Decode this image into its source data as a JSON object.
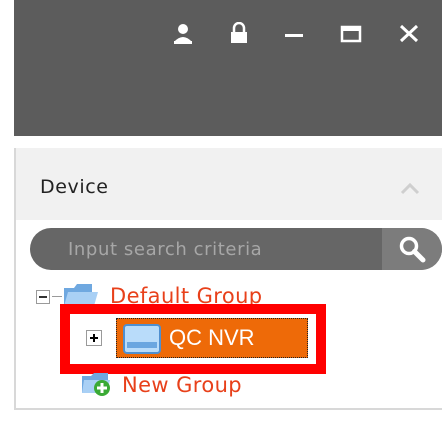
{
  "window": {
    "controls": [
      "user-icon",
      "lock-icon",
      "minimize-icon",
      "maximize-icon",
      "close-icon"
    ]
  },
  "panel": {
    "title": "Device"
  },
  "search": {
    "placeholder": "Input search criteria"
  },
  "tree": {
    "group_label": "Default Group",
    "device_label": "QC NVR",
    "new_group_label": "New Group"
  },
  "colors": {
    "titlebar": "#5c5c5c",
    "node_text": "#e8401a",
    "selected_node": "#ee6a08",
    "highlight": "#ff0000"
  }
}
